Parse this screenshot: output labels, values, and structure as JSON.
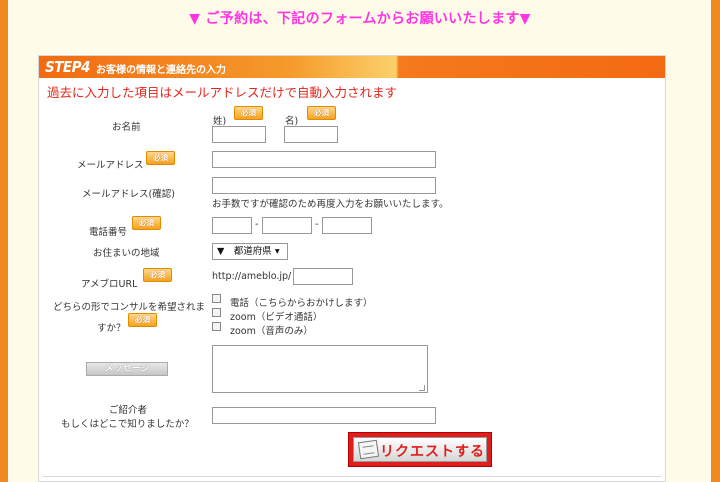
{
  "announcement": "▼ ご予約は、下記のフォームからお願いいたします▼",
  "step": {
    "number": "STEP4",
    "title": "お客様の情報と連絡先の入力"
  },
  "notice": "過去に入力した項目はメールアドレスだけで自動入力されます",
  "required_badge": "必須",
  "fields": {
    "name": {
      "label": "お名前",
      "last_label": "姓)",
      "first_label": "名)",
      "last_value": "",
      "first_value": ""
    },
    "email": {
      "label": "メールアドレス",
      "value": ""
    },
    "email_confirm": {
      "label": "メールアドレス(確認)",
      "value": "",
      "help": "お手数ですが確認のため再度入力をお願いいたします。"
    },
    "phone": {
      "label": "電話番号",
      "sep": "-",
      "part1": "",
      "part2": "",
      "part3": ""
    },
    "region": {
      "label": "お住まいの地域",
      "selected": "▼　都道府県 ▾"
    },
    "ameblo": {
      "label": "アメブロURL",
      "prefix": "http://ameblo.jp/",
      "value": ""
    },
    "consult": {
      "label_line1": "どちらの形でコンサルを希望されま",
      "label_line2": "すか？",
      "options": [
        "電話（こちらからおかけします）",
        "zoom（ビデオ通話）",
        "zoom（音声のみ）"
      ]
    },
    "message": {
      "button_label": "メッセージ",
      "value": ""
    },
    "referrer": {
      "label_line1": "ご紹介者",
      "label_line2": "もしくはどこで知りましたか？",
      "value": ""
    }
  },
  "submit_label": "リクエストする",
  "colors": {
    "frame": "#f08a1e",
    "announcement": "#ff35e3",
    "notice": "#e6241a",
    "submit": "#e01d1d"
  }
}
